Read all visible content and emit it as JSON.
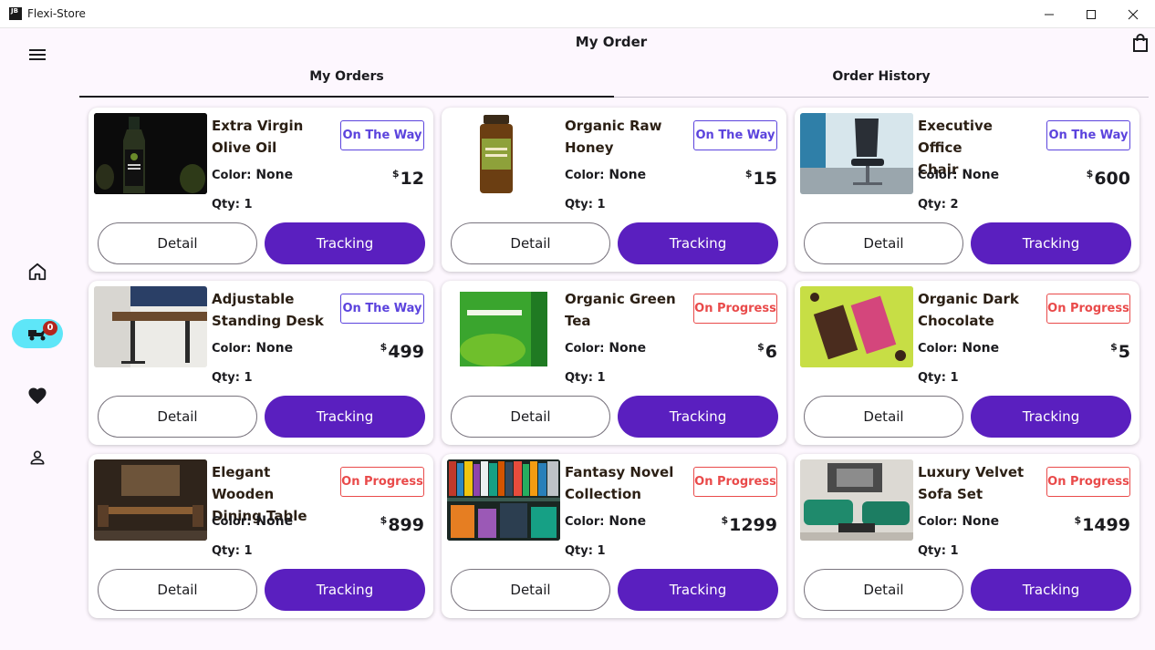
{
  "window": {
    "app_icon": "JB",
    "title": "Flexi-Store"
  },
  "header": {
    "title": "My Order"
  },
  "tabs": [
    {
      "label": "My Orders"
    },
    {
      "label": "Order History"
    }
  ],
  "nav": {
    "orders_badge": "0"
  },
  "colors": {
    "accent": "#5a1fbf",
    "on_the_way": "#5b43dd",
    "on_progress": "#e94a4a",
    "nav_active": "#5ee6f8"
  },
  "orders": [
    {
      "name_1": "Extra Virgin",
      "name_2": "Olive Oil",
      "status": "On The Way",
      "color_label": "Color:",
      "color": "None",
      "currency": "$",
      "price": "12",
      "qty_label": "Qty:",
      "qty": "1",
      "detail_label": "Detail",
      "tracking_label": "Tracking"
    },
    {
      "name_1": "Organic Raw",
      "name_2": "Honey",
      "status": "On The Way",
      "color_label": "Color:",
      "color": "None",
      "currency": "$",
      "price": "15",
      "qty_label": "Qty:",
      "qty": "1",
      "detail_label": "Detail",
      "tracking_label": "Tracking"
    },
    {
      "name_1": "Executive Office",
      "name_2": "Chair",
      "status": "On The Way",
      "color_label": "Color:",
      "color": "None",
      "currency": "$",
      "price": "600",
      "qty_label": "Qty:",
      "qty": "2",
      "detail_label": "Detail",
      "tracking_label": "Tracking"
    },
    {
      "name_1": "Adjustable",
      "name_2": "Standing Desk",
      "status": "On The Way",
      "color_label": "Color:",
      "color": "None",
      "currency": "$",
      "price": "499",
      "qty_label": "Qty:",
      "qty": "1",
      "detail_label": "Detail",
      "tracking_label": "Tracking"
    },
    {
      "name_1": "Organic Green",
      "name_2": "Tea",
      "status": "On Progress",
      "color_label": "Color:",
      "color": "None",
      "currency": "$",
      "price": "6",
      "qty_label": "Qty:",
      "qty": "1",
      "detail_label": "Detail",
      "tracking_label": "Tracking"
    },
    {
      "name_1": "Organic Dark",
      "name_2": "Chocolate",
      "status": "On Progress",
      "color_label": "Color:",
      "color": "None",
      "currency": "$",
      "price": "5",
      "qty_label": "Qty:",
      "qty": "1",
      "detail_label": "Detail",
      "tracking_label": "Tracking"
    },
    {
      "name_1": "Elegant Wooden",
      "name_2": "Dining Table",
      "status": "On Progress",
      "color_label": "Color:",
      "color": "None",
      "currency": "$",
      "price": "899",
      "qty_label": "Qty:",
      "qty": "1",
      "detail_label": "Detail",
      "tracking_label": "Tracking"
    },
    {
      "name_1": "Fantasy Novel",
      "name_2": "Collection",
      "status": "On Progress",
      "color_label": "Color:",
      "color": "None",
      "currency": "$",
      "price": "1299",
      "qty_label": "Qty:",
      "qty": "1",
      "detail_label": "Detail",
      "tracking_label": "Tracking"
    },
    {
      "name_1": "Luxury Velvet",
      "name_2": "Sofa Set",
      "status": "On Progress",
      "color_label": "Color:",
      "color": "None",
      "currency": "$",
      "price": "1499",
      "qty_label": "Qty:",
      "qty": "1",
      "detail_label": "Detail",
      "tracking_label": "Tracking"
    }
  ]
}
